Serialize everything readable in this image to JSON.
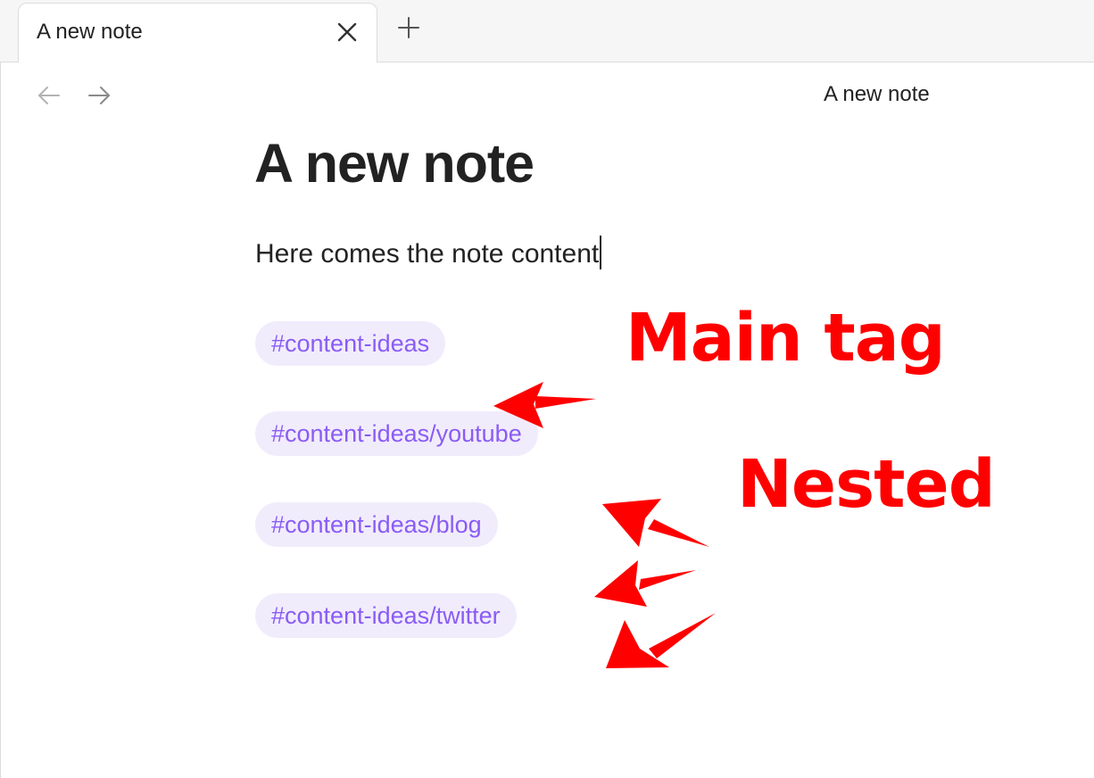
{
  "tab": {
    "title": "A new note",
    "close_icon": "close-icon",
    "new_tab_icon": "plus-icon"
  },
  "nav": {
    "back_icon": "arrow-left-icon",
    "forward_icon": "arrow-right-icon",
    "view_title": "A new note"
  },
  "note": {
    "title": "A new note",
    "body": "Here comes the note content",
    "tags": [
      "#content-ideas",
      "#content-ideas/youtube",
      "#content-ideas/blog",
      "#content-ideas/twitter"
    ]
  },
  "annotations": {
    "main": "Main tag",
    "nested": "Nested",
    "color": "#ff0000"
  },
  "colors": {
    "tag_text": "#8a5cf5",
    "tag_background": "#f1ecfc"
  }
}
